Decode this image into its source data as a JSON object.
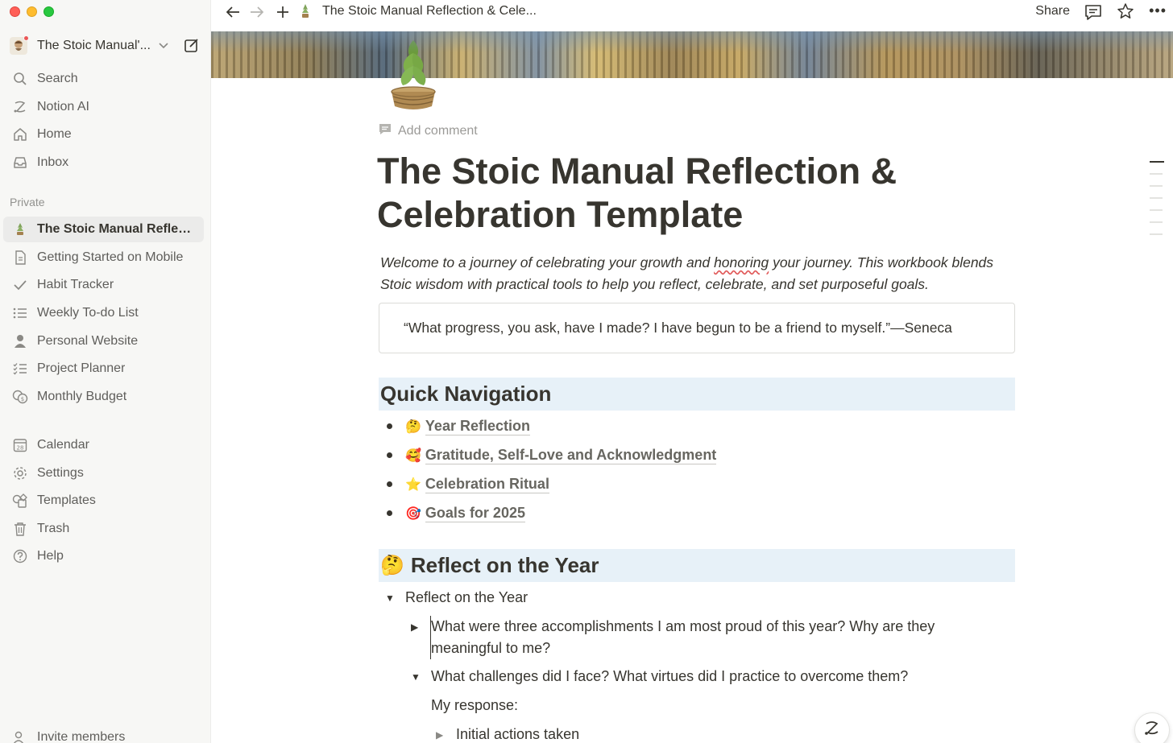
{
  "window": {
    "title": "The Stoic Manual Reflection & Cele..."
  },
  "workspace": {
    "name": "The Stoic Manual'..."
  },
  "sidebar": {
    "top_items": [
      {
        "label": "Search",
        "icon": "search-icon"
      },
      {
        "label": "Notion AI",
        "icon": "notion-ai-icon"
      },
      {
        "label": "Home",
        "icon": "home-icon"
      },
      {
        "label": "Inbox",
        "icon": "inbox-icon"
      }
    ],
    "section_label": "Private",
    "private_items": [
      {
        "label": "The Stoic Manual Reflect...",
        "icon": "laurel-page-icon",
        "active": true
      },
      {
        "label": "Getting Started on Mobile",
        "icon": "document-icon"
      },
      {
        "label": "Habit Tracker",
        "icon": "checkmark-icon"
      },
      {
        "label": "Weekly To-do List",
        "icon": "list-icon"
      },
      {
        "label": "Personal Website",
        "icon": "person-icon"
      },
      {
        "label": "Project Planner",
        "icon": "checklist-icon"
      },
      {
        "label": "Monthly Budget",
        "icon": "coins-icon"
      }
    ],
    "bottom_items": [
      {
        "label": "Calendar",
        "icon": "calendar-icon",
        "badge": "28"
      },
      {
        "label": "Settings",
        "icon": "gear-icon"
      },
      {
        "label": "Templates",
        "icon": "templates-icon"
      },
      {
        "label": "Trash",
        "icon": "trash-icon"
      },
      {
        "label": "Help",
        "icon": "help-icon"
      }
    ],
    "invite_label": "Invite members"
  },
  "topbar": {
    "share_label": "Share",
    "more_label": "•••"
  },
  "page": {
    "add_comment": "Add comment",
    "title": "The Stoic Manual Reflection & Celebration Template",
    "intro_part1": "Welcome to a journey of celebrating your growth and ",
    "intro_underlined": "honoring",
    "intro_part2": " your journey. This workbook blends Stoic wisdom with practical tools to help you reflect, celebrate, and set purposeful goals.",
    "quote": "“What progress, you ask, have I made? I have begun to be a friend to myself.”—Seneca",
    "quick_nav_heading": "Quick Navigation",
    "quick_nav": [
      {
        "emoji": "🤔",
        "label": "Year Reflection"
      },
      {
        "emoji": "🥰",
        "label": "Gratitude, Self-Love and Acknowledgment"
      },
      {
        "emoji": "⭐",
        "label": "Celebration Ritual"
      },
      {
        "emoji": "🎯",
        "label": "Goals for 2025"
      }
    ],
    "reflect_heading_emoji": "🤔",
    "reflect_heading": "Reflect on the Year",
    "toggle_main": "Reflect on the Year",
    "q1": "What were three accomplishments I am most proud of this year? Why are they meaningful to me?",
    "q2": "What challenges did I face? What virtues did I practice to overcome them?",
    "my_response": "My response:",
    "initial_actions": "Initial actions taken"
  },
  "colors": {
    "heading_bg": "#e7f1f8",
    "sidebar_bg": "#f7f7f5",
    "text": "#37352f"
  }
}
